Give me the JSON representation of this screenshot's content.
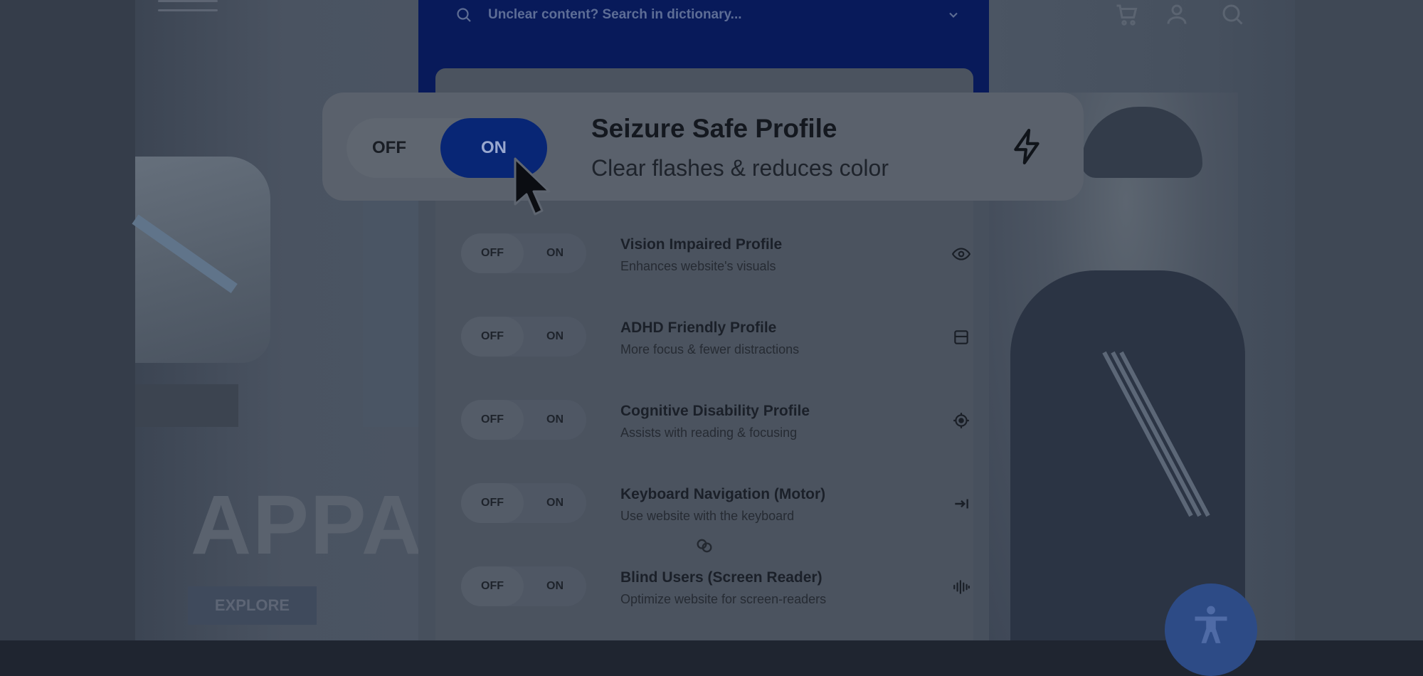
{
  "search": {
    "placeholder": "Unclear content? Search in dictionary..."
  },
  "highlighted_profile": {
    "off_label": "OFF",
    "on_label": "ON",
    "title": "Seizure Safe Profile",
    "description": "Clear flashes & reduces color",
    "icon": "lightning-bolt-icon",
    "state": "on"
  },
  "profiles": [
    {
      "off_label": "OFF",
      "on_label": "ON",
      "title": "Vision Impaired Profile",
      "description": "Enhances website's visuals",
      "icon": "eye-icon"
    },
    {
      "off_label": "OFF",
      "on_label": "ON",
      "title": "ADHD Friendly Profile",
      "description": "More focus & fewer distractions",
      "icon": "layout-icon"
    },
    {
      "off_label": "OFF",
      "on_label": "ON",
      "title": "Cognitive Disability Profile",
      "description": "Assists with reading & focusing",
      "icon": "target-icon"
    },
    {
      "off_label": "OFF",
      "on_label": "ON",
      "title": "Keyboard Navigation (Motor)",
      "description": "Use website with the keyboard",
      "icon": "arrow-to-line-icon"
    },
    {
      "off_label": "OFF",
      "on_label": "ON",
      "title": "Blind Users (Screen Reader)",
      "description": "Optimize website for screen-readers",
      "icon": "sound-wave-icon"
    }
  ],
  "background_site": {
    "hero_title": "APPAR",
    "hero_button": "EXPLORE"
  },
  "colors": {
    "header_blue": "#081a5a",
    "on_toggle_blue": "#082675",
    "fab_blue": "#2d4b86"
  }
}
